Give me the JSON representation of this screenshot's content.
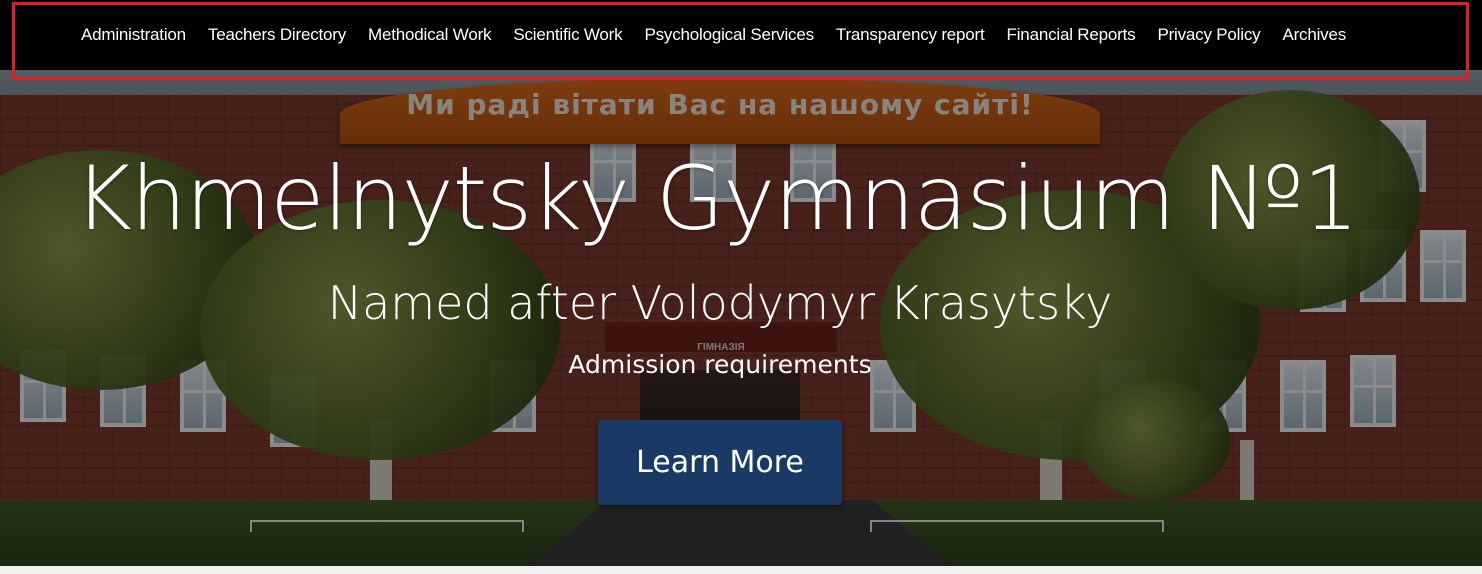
{
  "nav": {
    "items": [
      {
        "label": "Administration"
      },
      {
        "label": "Teachers Directory"
      },
      {
        "label": "Methodical Work"
      },
      {
        "label": "Scientific Work"
      },
      {
        "label": "Psychological Services"
      },
      {
        "label": "Transparency report"
      },
      {
        "label": "Financial Reports"
      },
      {
        "label": "Privacy Policy"
      },
      {
        "label": "Archives"
      }
    ]
  },
  "hero": {
    "banner_text": "Ми раді вітати Вас на нашому сайті!",
    "building_sign": "ГІМНАЗІЯ",
    "title": "Khmelnytsky Gymnasium №1",
    "subtitle": "Named after Volodymyr Krasytsky",
    "link": "Admission requirements",
    "button_label": "Learn More"
  },
  "colors": {
    "navbar": "#000000",
    "highlight_border": "#e02020",
    "button": "#1a3a66"
  }
}
